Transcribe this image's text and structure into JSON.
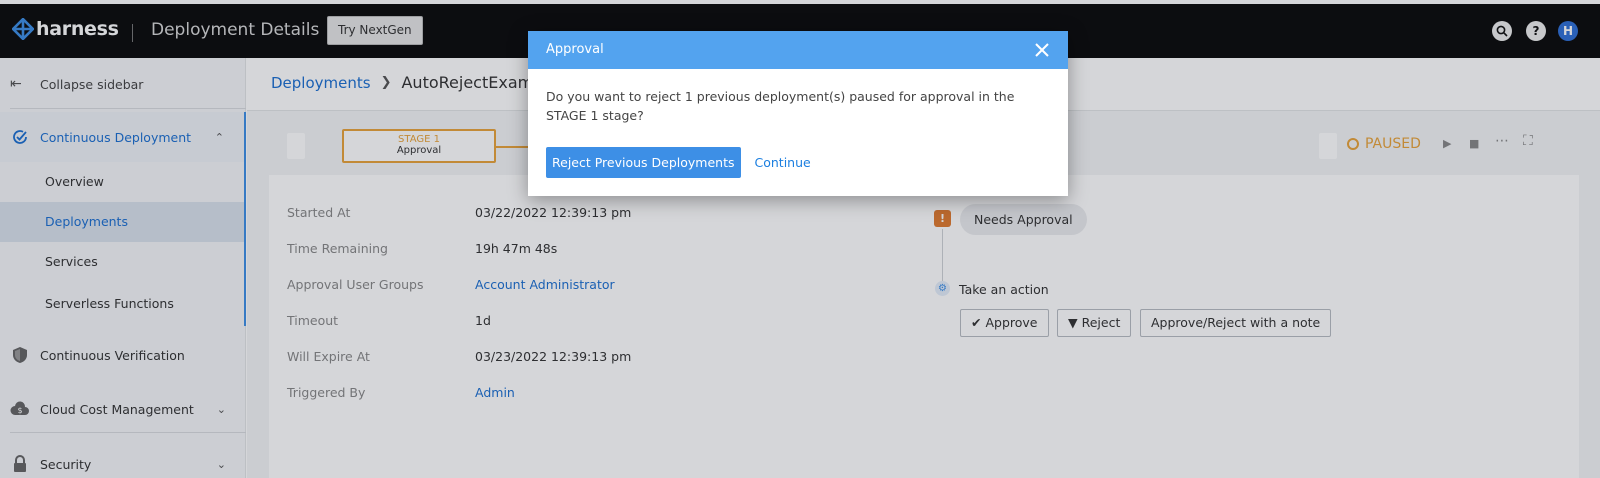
{
  "app": {
    "logo_text": "harness",
    "page_title": "Deployment Details",
    "try_button": "Try NextGen",
    "avatar_initial": "H",
    "help_label": "?"
  },
  "sidebar": {
    "collapse_label": "Collapse sidebar",
    "groups": [
      {
        "label": "Continuous Deployment",
        "icon": "check-circle-icon",
        "expanded": true
      },
      {
        "label": "Continuous Verification",
        "icon": "shield-icon"
      },
      {
        "label": "Cloud Cost Management",
        "icon": "cloud-dollar-icon"
      },
      {
        "label": "Security",
        "icon": "lock-icon"
      }
    ],
    "sub_items": [
      {
        "label": "Overview"
      },
      {
        "label": "Deployments",
        "active": true
      },
      {
        "label": "Services"
      },
      {
        "label": "Serverless Functions"
      }
    ]
  },
  "breadcrumb": {
    "root": "Deployments",
    "current": "AutoRejectExample"
  },
  "pipeline": {
    "stage_name": "STAGE 1",
    "stage_type": "Approval",
    "status": "PAUSED",
    "status_color": "#e8a33a"
  },
  "details": [
    {
      "label": "Started At",
      "value": "03/22/2022 12:39:13 pm",
      "link": false
    },
    {
      "label": "Time Remaining",
      "value": "19h 47m 48s",
      "link": false
    },
    {
      "label": "Approval User Groups",
      "value": "Account Administrator",
      "link": true
    },
    {
      "label": "Timeout",
      "value": "1d",
      "link": false
    },
    {
      "label": "Will Expire At",
      "value": "03/23/2022 12:39:13 pm",
      "link": false
    },
    {
      "label": "Triggered By",
      "value": "Admin",
      "link": true
    }
  ],
  "approval_panel": {
    "badge": "!",
    "needs_approval": "Needs Approval",
    "take_action": "Take an action",
    "approve": "Approve",
    "reject": "Reject",
    "approve_reject_note": "Approve/Reject with a note"
  },
  "modal": {
    "title": "Approval",
    "message": "Do you want to reject 1 previous deployment(s) paused for approval in the STAGE 1 stage?",
    "primary_button": "Reject Previous Deployments",
    "secondary_link": "Continue",
    "header_color": "#53a3ef"
  }
}
